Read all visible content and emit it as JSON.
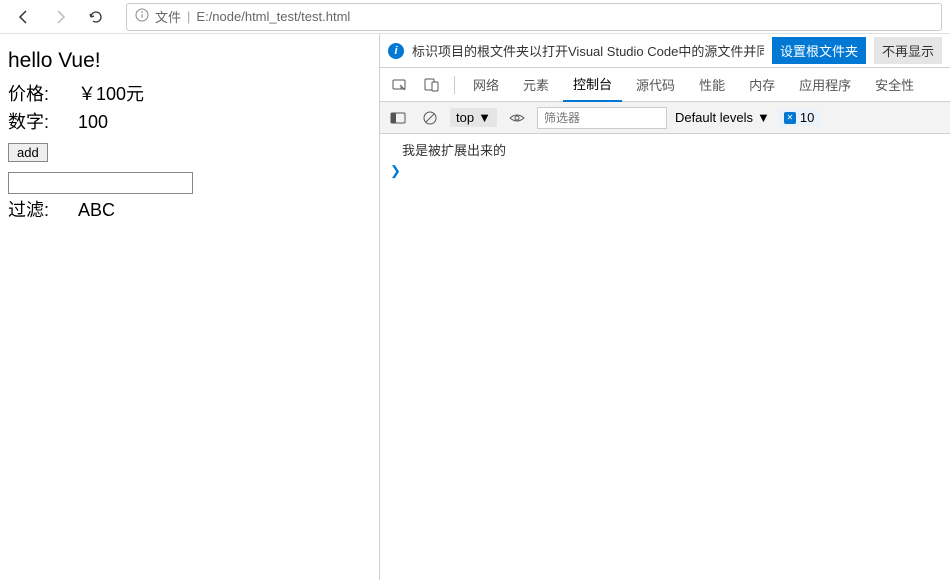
{
  "browser": {
    "addr_label": "文件",
    "url": "E:/node/html_test/test.html"
  },
  "page": {
    "title": "hello Vue!",
    "rows": [
      {
        "label": "价格:",
        "value": "￥100元"
      },
      {
        "label": "数字:",
        "value": "100"
      }
    ],
    "add_btn": "add",
    "filter_label": "过滤:",
    "filter_value": "ABC"
  },
  "devtools": {
    "info_text": "标识项目的根文件夹以打开Visual Studio Code中的源文件并同步更改。",
    "set_root_btn": "设置根文件夹",
    "dismiss_btn": "不再显示",
    "tabs": [
      "网络",
      "元素",
      "控制台",
      "源代码",
      "性能",
      "内存",
      "应用程序",
      "安全性"
    ],
    "active_tab": "控制台",
    "context": "top",
    "filter_placeholder": "筛选器",
    "levels": "Default levels",
    "issues_count": "10",
    "log": "我是被扩展出来的"
  }
}
